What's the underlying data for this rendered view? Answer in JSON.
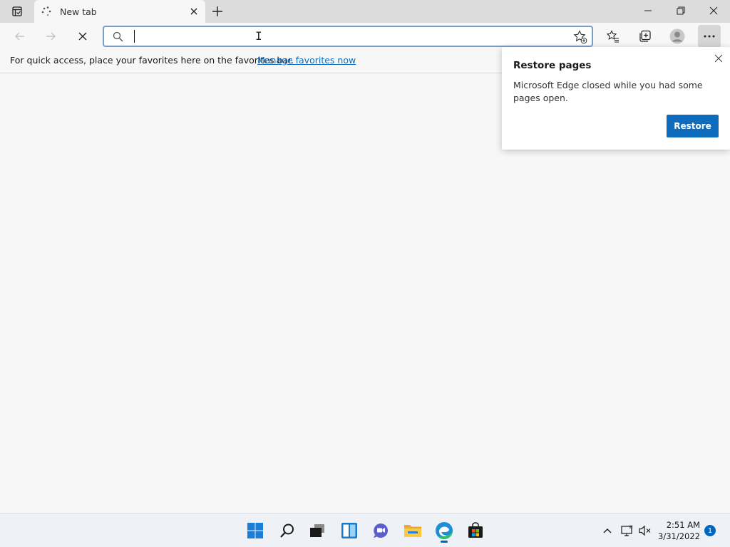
{
  "tab": {
    "title": "New tab"
  },
  "address_bar": {
    "value": "",
    "placeholder": ""
  },
  "favorites_bar": {
    "message": "For quick access, place your favorites here on the favorites bar.",
    "link": "Manage favorites now"
  },
  "restore_popup": {
    "title": "Restore pages",
    "body": "Microsoft Edge closed while you had some pages open.",
    "button": "Restore"
  },
  "taskbar": {
    "apps": [
      "start-icon",
      "search-icon",
      "task-view-icon",
      "widgets-icon",
      "teams-chat-icon",
      "file-explorer-icon",
      "edge-icon",
      "store-icon"
    ],
    "clock": {
      "time": "2:51 AM",
      "date": "3/31/2022"
    },
    "notification_count": "1"
  },
  "colors": {
    "accent": "#0f6cbd",
    "taskbar_accent": "#0067c0",
    "tabbar_bg": "#dcdcdc",
    "page_bg": "#f7f7f7"
  }
}
